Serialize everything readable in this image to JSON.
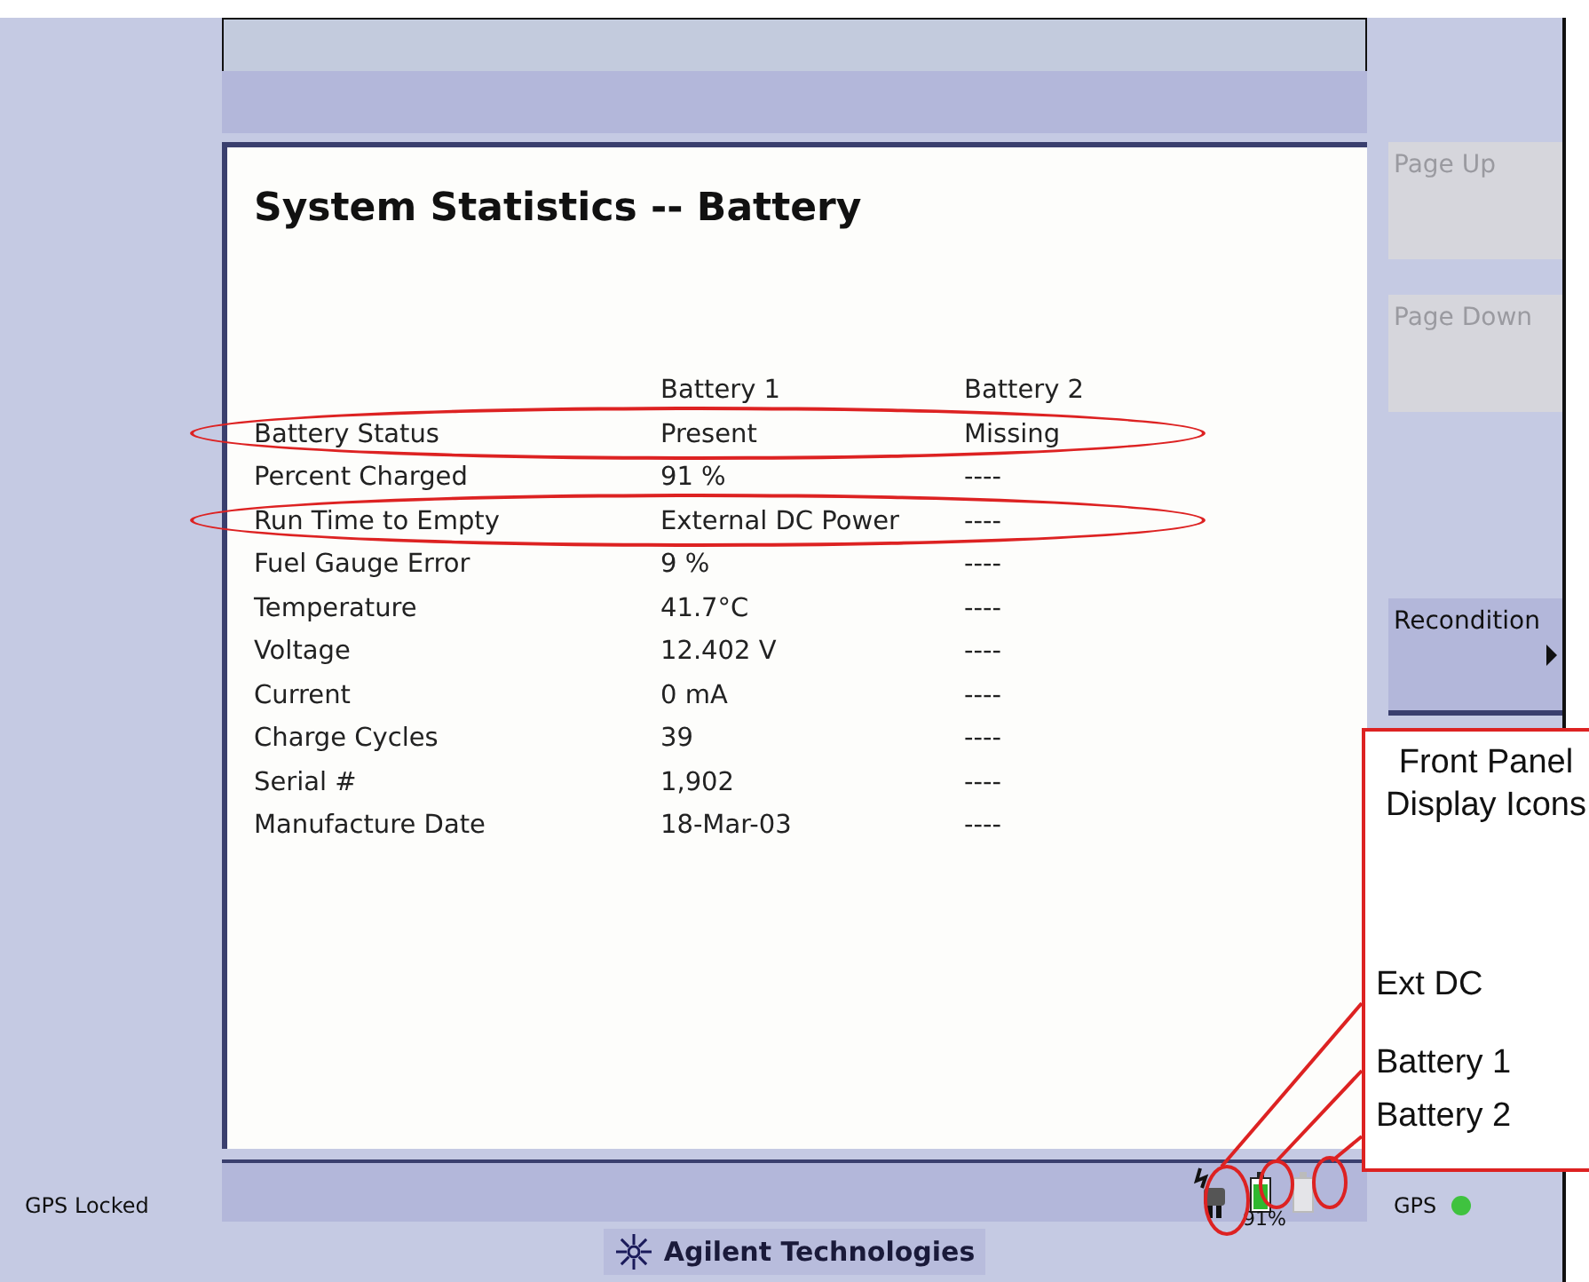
{
  "screen_title": "System Statistics -- Battery",
  "columns": [
    "Battery 1",
    "Battery 2"
  ],
  "rows": [
    {
      "label": "Battery Status",
      "values": [
        "Present",
        "Missing"
      ],
      "circled": true
    },
    {
      "label": "Percent Charged",
      "values": [
        "91 %",
        "----"
      ],
      "circled": false
    },
    {
      "label": "Run Time to Empty",
      "values": [
        "External DC Power",
        "----"
      ],
      "circled": true
    },
    {
      "label": "Fuel Gauge Error",
      "values": [
        "9 %",
        "----"
      ],
      "circled": false
    },
    {
      "label": "Temperature",
      "values": [
        "41.7°C",
        "----"
      ],
      "circled": false
    },
    {
      "label": "Voltage",
      "values": [
        "12.402 V",
        "----"
      ],
      "circled": false
    },
    {
      "label": "Current",
      "values": [
        "0 mA",
        "----"
      ],
      "circled": false
    },
    {
      "label": "Charge Cycles",
      "values": [
        "39",
        "----"
      ],
      "circled": false
    },
    {
      "label": "Serial #",
      "values": [
        "1,902",
        "----"
      ],
      "circled": false
    },
    {
      "label": "Manufacture Date",
      "values": [
        "18-Mar-03",
        "----"
      ],
      "circled": false
    }
  ],
  "softkeys": [
    {
      "label": "Page Up",
      "disabled": true,
      "submenu": false
    },
    {
      "label": "Page Down",
      "disabled": true,
      "submenu": false
    },
    {
      "label": "Recondition",
      "disabled": false,
      "submenu": true
    }
  ],
  "status_left": "GPS Locked",
  "batteries": [
    {
      "present": true,
      "level": 0.9,
      "reading": "91%"
    },
    {
      "present": false
    }
  ],
  "gps": {
    "label": "GPS",
    "on": true
  },
  "brand": "Agilent Technologies",
  "callout": {
    "title": "Front Panel Display Icons",
    "labels": [
      "Ext DC",
      "Battery 1",
      "Battery 2"
    ]
  }
}
